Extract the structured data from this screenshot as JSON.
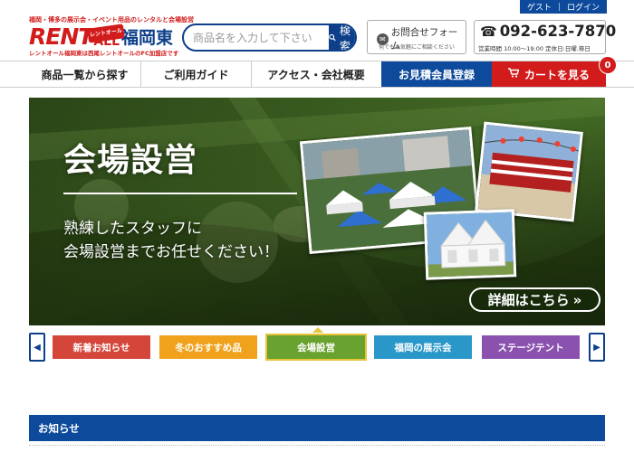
{
  "topbar": {
    "guest": "ゲスト",
    "login": "ログイン"
  },
  "header": {
    "tagline": "福岡・博多の展示会・イベント用品のレンタルと会場設営",
    "logo_rent": "RENT",
    "logo_all": "ALL",
    "logo_ruby": "レントオール",
    "logo_branch": "福岡東",
    "subtag": "レントオール福岡東は西尾レントオールのFC加盟店です",
    "search_placeholder": "商品名を入力して下さい",
    "search_button": "検索",
    "contact_label": "お問合せフォーム",
    "contact_note": "何でもお気軽にご相談ください",
    "phone": "092-623-7870",
    "hours": "営業時間 10:00〜19:00 定休日:日曜.祭日"
  },
  "nav": {
    "products": "商品一覧から探す",
    "guide": "ご利用ガイド",
    "access": "アクセス・会社概要",
    "register": "お見積会員登録",
    "cart": "カートを見る",
    "cart_count": "0"
  },
  "hero": {
    "title": "会場設営",
    "line1": "熟練したスタッフに",
    "line2": "会場設営までお任せください！",
    "more": "詳細はこちら"
  },
  "tabs": [
    {
      "label": "新着お知らせ",
      "color": "#d4453a"
    },
    {
      "label": "冬のおすすめ品",
      "color": "#f0a21c"
    },
    {
      "label": "会場設営",
      "color": "#6aa22f"
    },
    {
      "label": "福岡の展示会",
      "color": "#2a97c9"
    },
    {
      "label": "ステージテント",
      "color": "#8a52ae"
    }
  ],
  "news": {
    "title": "お知らせ"
  },
  "colors": {
    "brand_blue": "#0d4a9c",
    "brand_red": "#d21b1b"
  }
}
